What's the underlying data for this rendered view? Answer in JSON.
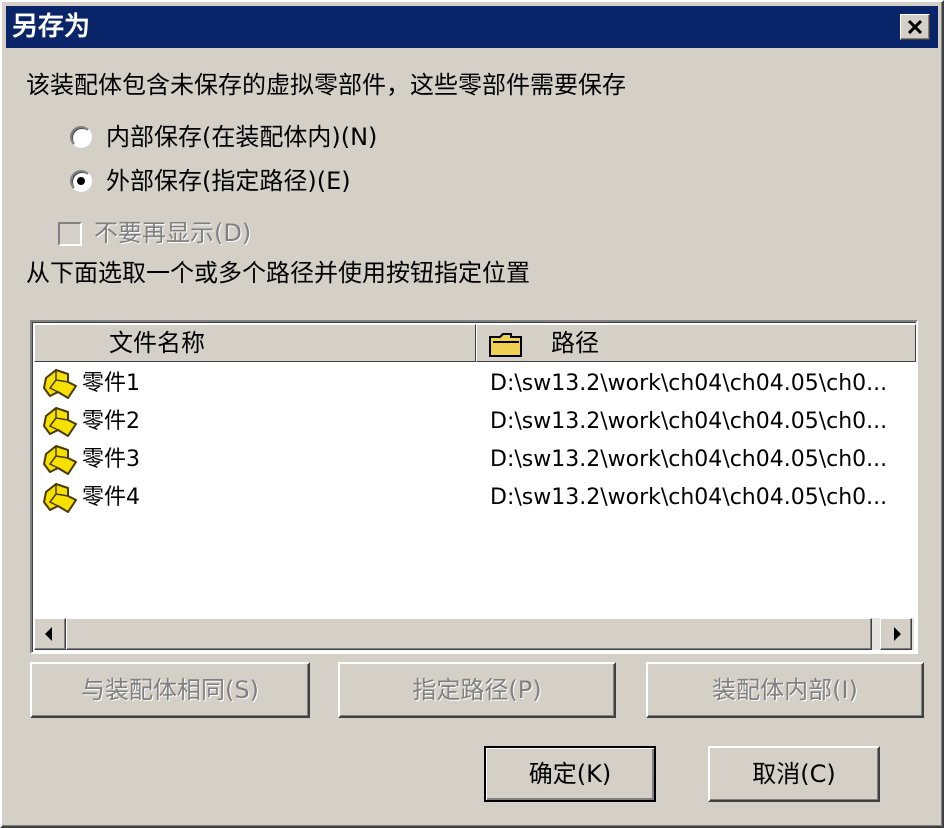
{
  "window": {
    "title": "另存为"
  },
  "message": "该装配体包含未保存的虚拟零部件，这些零部件需要保存",
  "options": {
    "internal_label": "内部保存(在装配体内)(N)",
    "external_label": "外部保存(指定路径)(E)",
    "selected": "external"
  },
  "dont_show_label": "不要再显示(D)",
  "instruction": "从下面选取一个或多个路径并使用按钮指定位置",
  "table": {
    "columns": [
      "文件名称",
      "路径"
    ],
    "rows": [
      {
        "name": "零件1",
        "path": "D:\\sw13.2\\work\\ch04\\ch04.05\\ch0..."
      },
      {
        "name": "零件2",
        "path": "D:\\sw13.2\\work\\ch04\\ch04.05\\ch0..."
      },
      {
        "name": "零件3",
        "path": "D:\\sw13.2\\work\\ch04\\ch04.05\\ch0..."
      },
      {
        "name": "零件4",
        "path": "D:\\sw13.2\\work\\ch04\\ch04.05\\ch0..."
      }
    ]
  },
  "action_buttons": {
    "same_as_assembly": "与装配体相同(S)",
    "specify_path": "指定路径(P)",
    "inside_assembly": "装配体内部(I)"
  },
  "dialog_buttons": {
    "ok": "确定(K)",
    "cancel": "取消(C)"
  },
  "colors": {
    "titlebar": "#0a246a",
    "face": "#d4d0c8",
    "part_icon": "#f5e000"
  }
}
